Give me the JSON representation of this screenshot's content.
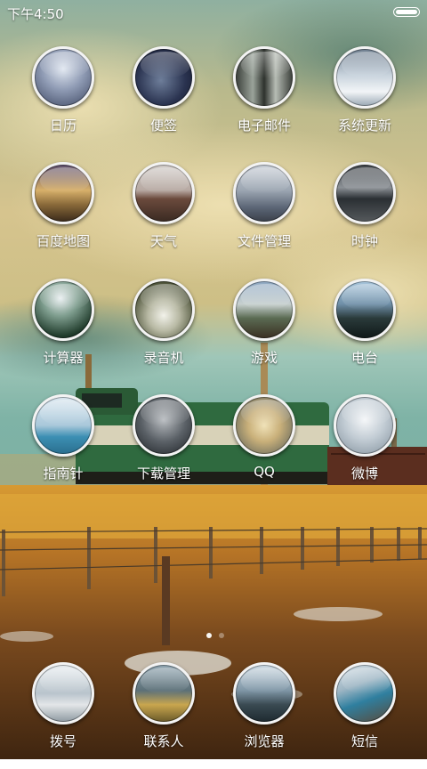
{
  "status_bar": {
    "time": "下午4:50",
    "battery_level": 1.0
  },
  "apps": [
    {
      "label": "日历",
      "icon": "calendar-icon"
    },
    {
      "label": "便签",
      "icon": "notes-icon"
    },
    {
      "label": "电子邮件",
      "icon": "email-icon"
    },
    {
      "label": "系统更新",
      "icon": "system-update-icon"
    },
    {
      "label": "百度地图",
      "icon": "map-icon"
    },
    {
      "label": "天气",
      "icon": "weather-icon"
    },
    {
      "label": "文件管理",
      "icon": "file-manager-icon"
    },
    {
      "label": "时钟",
      "icon": "clock-icon"
    },
    {
      "label": "计算器",
      "icon": "calculator-icon"
    },
    {
      "label": "录音机",
      "icon": "recorder-icon"
    },
    {
      "label": "游戏",
      "icon": "games-icon"
    },
    {
      "label": "电台",
      "icon": "radio-icon"
    },
    {
      "label": "指南针",
      "icon": "compass-icon"
    },
    {
      "label": "下载管理",
      "icon": "download-manager-icon"
    },
    {
      "label": "QQ",
      "icon": "qq-icon"
    },
    {
      "label": "微博",
      "icon": "weibo-icon"
    }
  ],
  "dock": [
    {
      "label": "拨号",
      "icon": "phone-icon"
    },
    {
      "label": "联系人",
      "icon": "contacts-icon"
    },
    {
      "label": "浏览器",
      "icon": "browser-icon"
    },
    {
      "label": "短信",
      "icon": "messages-icon"
    }
  ],
  "page_indicator": {
    "pages": 2,
    "current": 1
  }
}
